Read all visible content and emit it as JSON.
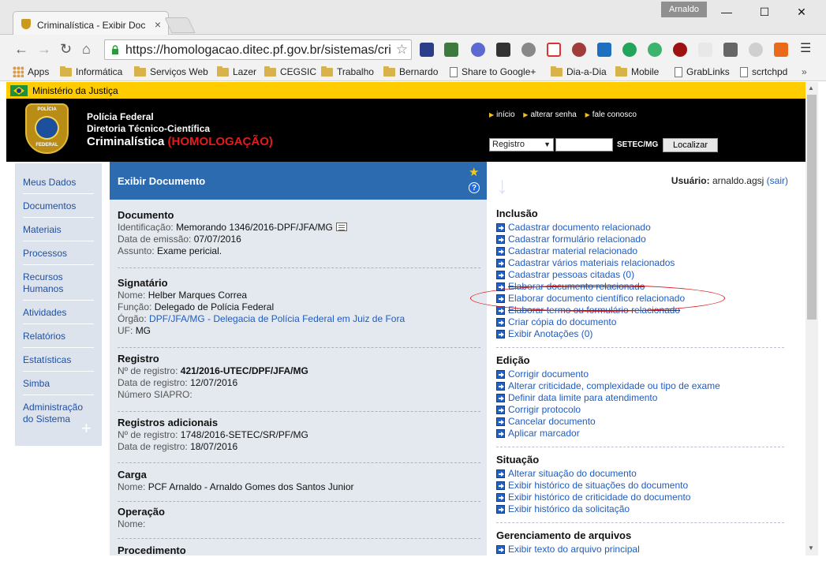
{
  "browser": {
    "tab_title": "Criminalística - Exibir Doc",
    "user_chip": "Arnaldo",
    "url": "https://homologacao.ditec.pf.gov.br/sistemas/cri"
  },
  "bookmarks": [
    {
      "label": "Apps",
      "icon": "apps-grid-icon"
    },
    {
      "label": "Informática",
      "icon": "folder-icon"
    },
    {
      "label": "Serviços Web",
      "icon": "folder-icon"
    },
    {
      "label": "Lazer",
      "icon": "folder-icon"
    },
    {
      "label": "CEGSIC",
      "icon": "folder-icon"
    },
    {
      "label": "Trabalho",
      "icon": "folder-icon"
    },
    {
      "label": "Bernardo",
      "icon": "folder-icon"
    },
    {
      "label": "Share to Google+",
      "icon": "page-icon"
    },
    {
      "label": "Dia-a-Dia",
      "icon": "folder-icon"
    },
    {
      "label": "Mobile",
      "icon": "folder-icon"
    },
    {
      "label": "GrabLinks",
      "icon": "page-icon"
    },
    {
      "label": "scrtchpd",
      "icon": "page-icon"
    }
  ],
  "gov_bar": {
    "label": "Ministério da Justiça"
  },
  "header": {
    "badge_top": "POLÍCIA",
    "badge_bottom": "FEDERAL",
    "line1": "Polícia Federal",
    "line2": "Diretoria Técnico-Científica",
    "line3": "Criminalística",
    "line3_tag": "(HOMOLOGAÇÃO)",
    "links": [
      "início",
      "alterar senha",
      "fale conosco"
    ],
    "search_select": "Registro",
    "search_unit": "SETEC/MG",
    "search_button": "Localizar"
  },
  "sidebar": {
    "items": [
      "Meus Dados",
      "Documentos",
      "Materiais",
      "Processos",
      "Recursos Humanos",
      "Atividades",
      "Relatórios",
      "Estatísticas",
      "Simba",
      "Administração do Sistema"
    ]
  },
  "main": {
    "title": "Exibir Documento",
    "documento": {
      "heading": "Documento",
      "id_label": "Identificação:",
      "id_value": "Memorando 1346/2016-DPF/JFA/MG",
      "date_label": "Data de emissão:",
      "date_value": "07/07/2016",
      "subject_label": "Assunto:",
      "subject_value": "Exame pericial."
    },
    "signatario": {
      "heading": "Signatário",
      "name_label": "Nome:",
      "name_value": "Helber Marques Correa",
      "role_label": "Função:",
      "role_value": "Delegado de Polícia Federal",
      "org_label": "Órgão:",
      "org_value": "DPF/JFA/MG - Delegacia de Polícia Federal em Juiz de Fora",
      "uf_label": "UF:",
      "uf_value": "MG"
    },
    "registro": {
      "heading": "Registro",
      "num_label": "Nº de registro:",
      "num_value": "421/2016-UTEC/DPF/JFA/MG",
      "date_label": "Data de registro:",
      "date_value": "12/07/2016",
      "siapro_label": "Número SIAPRO:"
    },
    "registros_adicionais": {
      "heading": "Registros adicionais",
      "num_label": "Nº de registro:",
      "num_value": "1748/2016-SETEC/SR/PF/MG",
      "date_label": "Data de registro:",
      "date_value": "18/07/2016"
    },
    "carga": {
      "heading": "Carga",
      "name_label": "Nome:",
      "name_value": "PCF Arnaldo - Arnaldo Gomes dos Santos Junior"
    },
    "operacao": {
      "heading": "Operação",
      "name_label": "Nome:"
    },
    "procedimento": {
      "heading": "Procedimento"
    }
  },
  "right": {
    "user_label": "Usuário:",
    "user_name": "arnaldo.agsj",
    "logout": "(sair)",
    "groups": [
      {
        "title": "Inclusão",
        "actions": [
          "Cadastrar documento relacionado",
          "Cadastrar formulário relacionado",
          "Cadastrar material relacionado",
          "Cadastrar vários materiais relacionados",
          "Cadastrar pessoas citadas (0)",
          "Elaborar documento relacionado",
          "Elaborar documento científico relacionado",
          "Elaborar termo ou formulário relacionado",
          "Criar cópia do documento",
          "Exibir Anotações (0)"
        ]
      },
      {
        "title": "Edição",
        "actions": [
          "Corrigir documento",
          "Alterar criticidade, complexidade ou tipo de exame",
          "Definir data limite para atendimento",
          "Corrigir protocolo",
          "Cancelar documento",
          "Aplicar marcador"
        ]
      },
      {
        "title": "Situação",
        "actions": [
          "Alterar situação do documento",
          "Exibir histórico de situações do documento",
          "Exibir histórico de criticidade do documento",
          "Exibir histórico da solicitação"
        ]
      },
      {
        "title": "Gerenciamento de arquivos",
        "actions": [
          "Exibir texto do arquivo principal"
        ]
      }
    ]
  },
  "colors": {
    "gov_yellow": "#ffcc00",
    "header_black": "#000000",
    "panel_blue": "#2d6bb0",
    "link_blue": "#1f5cc0",
    "homologacao_red": "#e21c1c",
    "annotation_red": "#d81c1c"
  }
}
